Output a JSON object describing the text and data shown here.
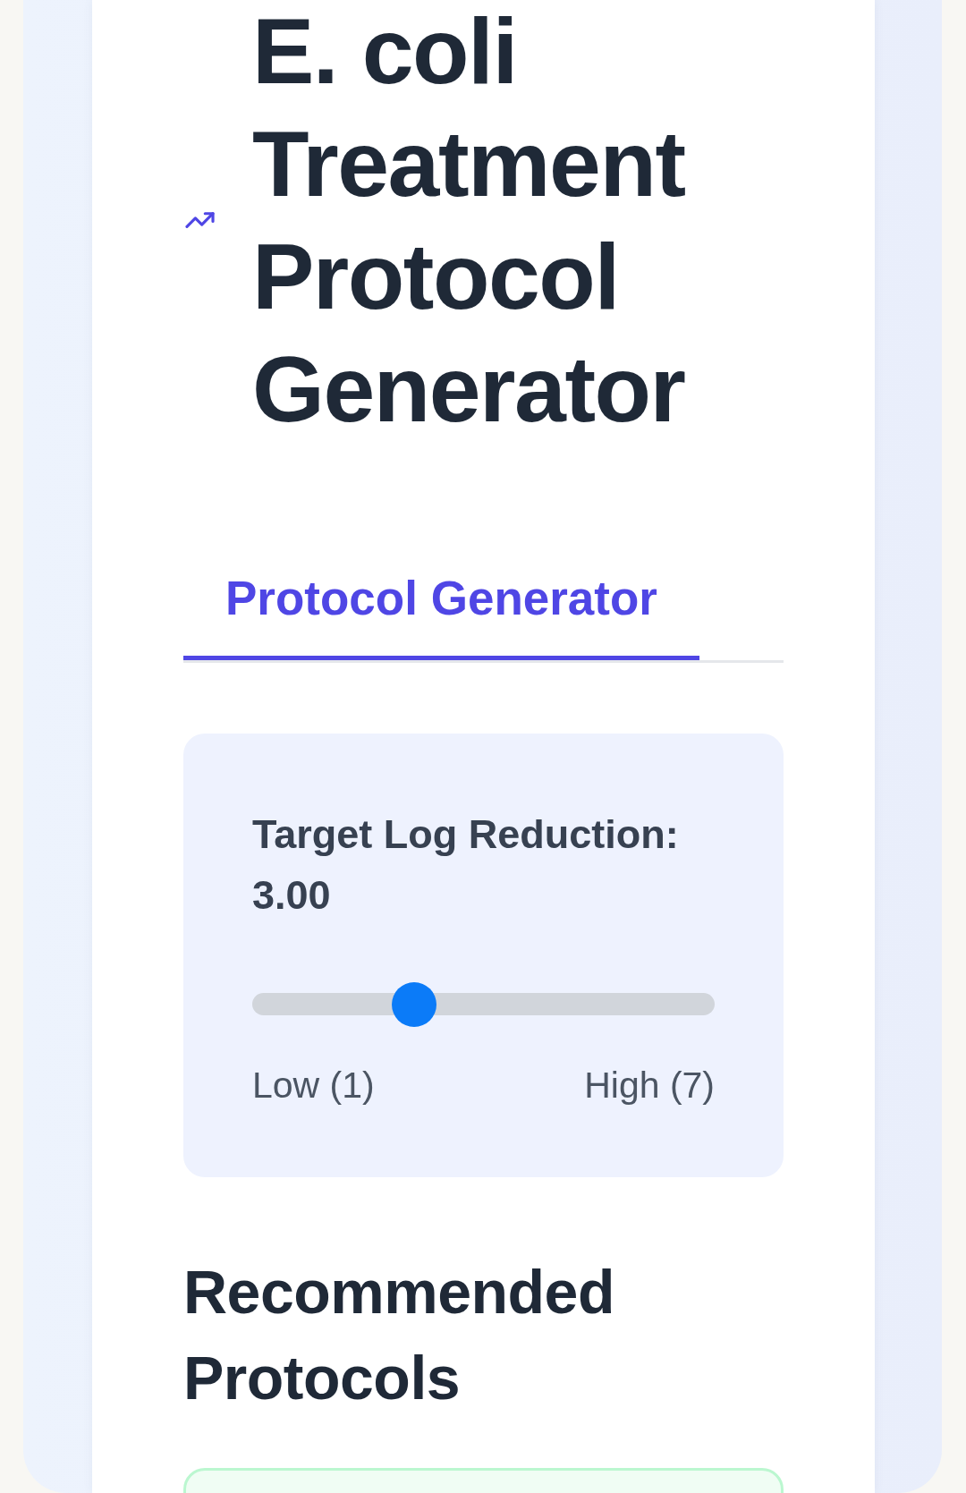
{
  "header": {
    "title": "E. coli Treatment Protocol Generator"
  },
  "tabs": [
    {
      "label": "Protocol Generator",
      "selected": true
    }
  ],
  "slider": {
    "label": "Target Log Reduction:",
    "reading": "3.00",
    "level": 0.333,
    "min_label": "Low (1)",
    "max_label": "High (7)"
  },
  "recommendations": {
    "heading": "Recommended Protocols",
    "cards": [
      {
        "kind": "highlighted"
      }
    ]
  }
}
